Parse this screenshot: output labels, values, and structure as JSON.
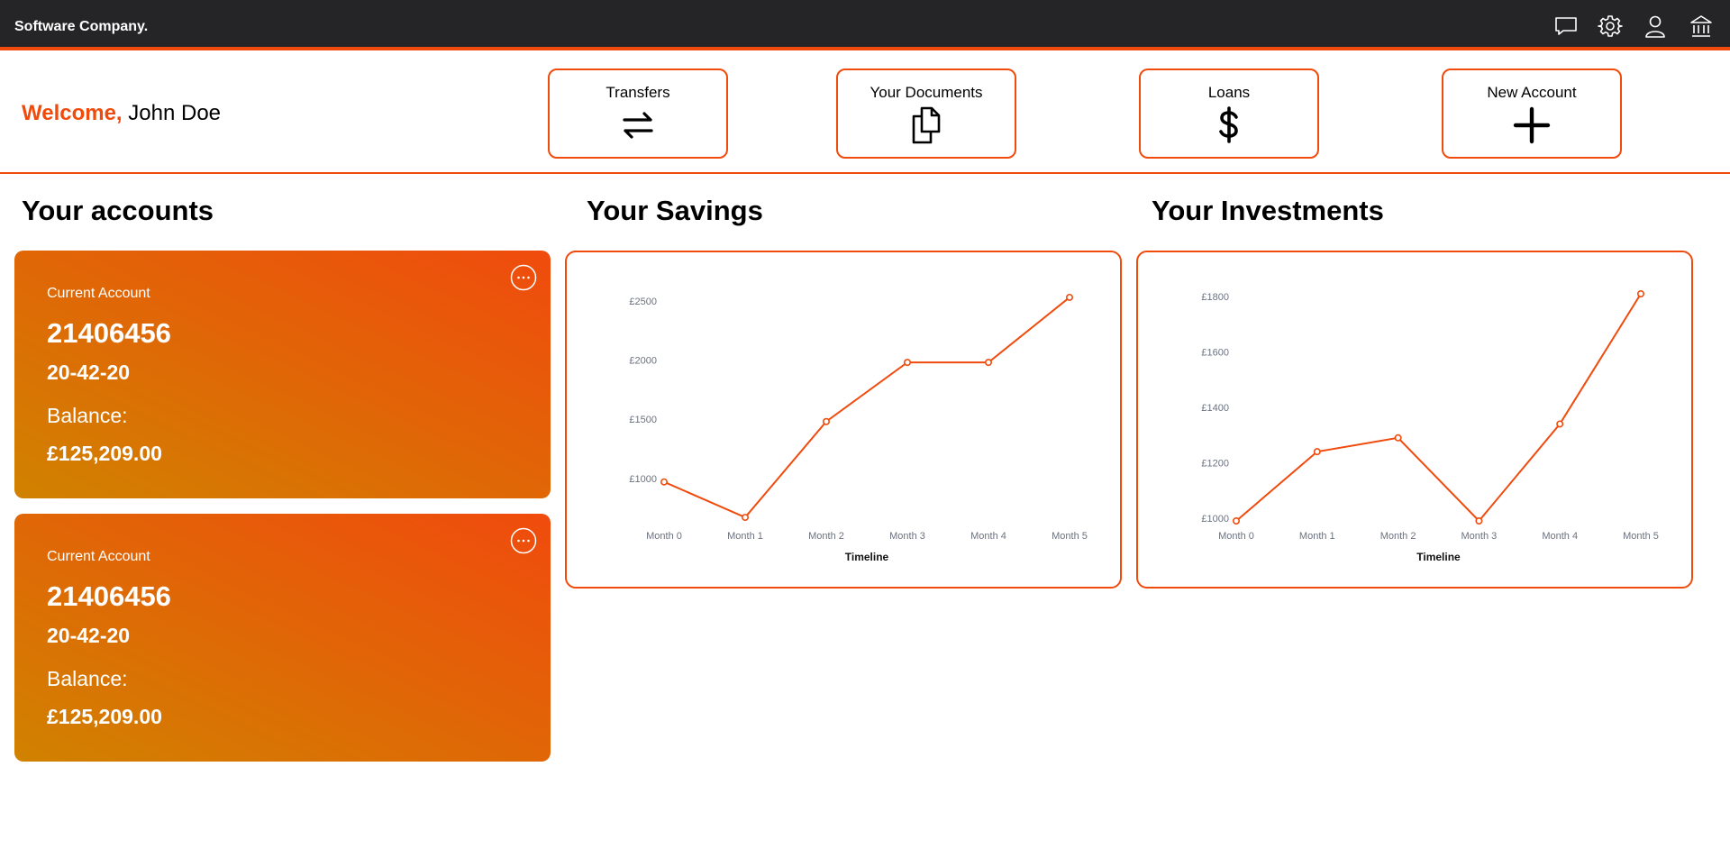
{
  "app": {
    "brand": "Software Company."
  },
  "topbar": {
    "icons": [
      "message-icon",
      "gear-icon",
      "user-icon",
      "bank-icon"
    ]
  },
  "welcome": {
    "greeting": "Welcome,",
    "name": "John Doe"
  },
  "actions": [
    {
      "label": "Transfers",
      "icon": "transfer-arrows-icon"
    },
    {
      "label": "Your Documents",
      "icon": "documents-icon"
    },
    {
      "label": "Loans",
      "icon": "dollar-icon"
    },
    {
      "label": "New Account",
      "icon": "plus-icon"
    }
  ],
  "sections": {
    "accounts": "Your accounts",
    "savings": "Your Savings",
    "investments": "Your Investments"
  },
  "accounts": [
    {
      "type": "Current Account",
      "number": "21406456",
      "sort_code": "20-42-20",
      "balance_label": "Balance:",
      "balance": "£125,209.00"
    },
    {
      "type": "Current Account",
      "number": "21406456",
      "sort_code": "20-42-20",
      "balance_label": "Balance:",
      "balance": "£125,209.00"
    }
  ],
  "colors": {
    "accent": "#f04b0d",
    "topbar": "#252527",
    "card_gradient_from": "#d08200",
    "card_gradient_to": "#f04b0d"
  },
  "chart_data": [
    {
      "type": "line",
      "x": [
        "Month 0",
        "Month 1",
        "Month 2",
        "Month 3",
        "Month 4",
        "Month 5"
      ],
      "values": [
        970,
        670,
        1480,
        1980,
        1980,
        2530
      ],
      "yticks": [
        "£1000",
        "£1500",
        "£2000",
        "£2500"
      ],
      "ytick_values": [
        1000,
        1500,
        2000,
        2500
      ],
      "ylim": [
        640,
        2560
      ],
      "xlabel": "Timeline",
      "ylabel": "",
      "grid": false
    },
    {
      "type": "line",
      "x": [
        "Month 0",
        "Month 1",
        "Month 2",
        "Month 3",
        "Month 4",
        "Month 5"
      ],
      "values": [
        990,
        1240,
        1290,
        990,
        1340,
        1810
      ],
      "yticks": [
        "£1000",
        "£1200",
        "£1400",
        "£1600",
        "£1800"
      ],
      "ytick_values": [
        1000,
        1200,
        1400,
        1600,
        1800
      ],
      "ylim": [
        990,
        1810
      ],
      "xlabel": "Timeline",
      "ylabel": "",
      "grid": false
    }
  ]
}
